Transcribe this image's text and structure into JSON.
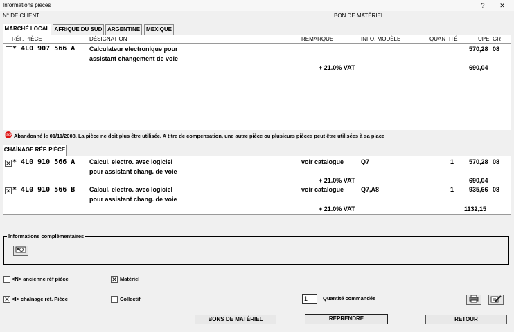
{
  "window": {
    "title": "Informations pièces",
    "help": "?",
    "close": "✕"
  },
  "header": {
    "client_label": "N° DE CLIENT",
    "doc_type": "BON DE MATÉRIEL"
  },
  "tabs": [
    "MARCHÉ LOCAL",
    "AFRIQUE DU SUD",
    "ARGENTINE",
    "MEXIQUE"
  ],
  "columns": {
    "ref": "RÉF. PIÈCE",
    "designation": "DÉSIGNATION",
    "remarque": "REMARQUE",
    "info": "INFO. MODÈLE",
    "qty": "QUANTITÉ",
    "upe": "UPE",
    "gr": "GR"
  },
  "top_item": {
    "ref": "* 4L0 907 566 A",
    "des1": "Calculateur electronique pour",
    "des2": "assistant changement de voie",
    "upe": "570,28",
    "gr": "08",
    "vat_label": "+ 21.0% VAT",
    "vat_total": "690,04",
    "checked": false
  },
  "notice": {
    "icon": "STOP",
    "text": "Abandonné le 01/11/2008. La pièce ne doit plus être utilisée. A titre de compensation, une autre pièce ou plusieurs pièces peut être utilisées à sa place"
  },
  "chain_tab": "CHAÎNAGE RÉF. PIÈCE",
  "chain_items": [
    {
      "ref": "* 4L0 910 566 A",
      "des1": "Calcul. electro. avec logiciel",
      "des2": "pour assistant chang. de voie",
      "remarque": "voir catalogue",
      "info": "Q7",
      "qty": "1",
      "upe": "570,28",
      "gr": "08",
      "vat_label": "+ 21.0% VAT",
      "vat_total": "690,04",
      "checked": true
    },
    {
      "ref": "* 4L0 910 566 B",
      "des1": "Calcul. electro. avec logiciel",
      "des2": "pour assistant chang. de voie",
      "remarque": "voir catalogue",
      "info": "Q7,A8",
      "qty": "1",
      "upe": "935,66",
      "gr": "08",
      "vat_label": "+ 21.0% VAT",
      "vat_total": "1132,15",
      "checked": true
    }
  ],
  "info_section": {
    "legend": "Informations complémentaires",
    "icon": "camera-card-icon"
  },
  "options": {
    "old_ref": {
      "label": "<N> ancienne réf pièce",
      "checked": false
    },
    "chain_ref": {
      "label": "<I> chaînage réf. Pièce",
      "checked": true
    },
    "materiel": {
      "label": "Matériel",
      "checked": true
    },
    "collectif": {
      "label": "Collectif",
      "checked": false
    }
  },
  "quantity": {
    "value": "1",
    "label": "Quantité commandée"
  },
  "buttons": {
    "bons": "BONS DE MATÉRIEL",
    "reprendre": "REPRENDRE",
    "retour": "RETOUR"
  },
  "colors": {
    "stop": "#d11111",
    "background": "#f0f0f0"
  }
}
